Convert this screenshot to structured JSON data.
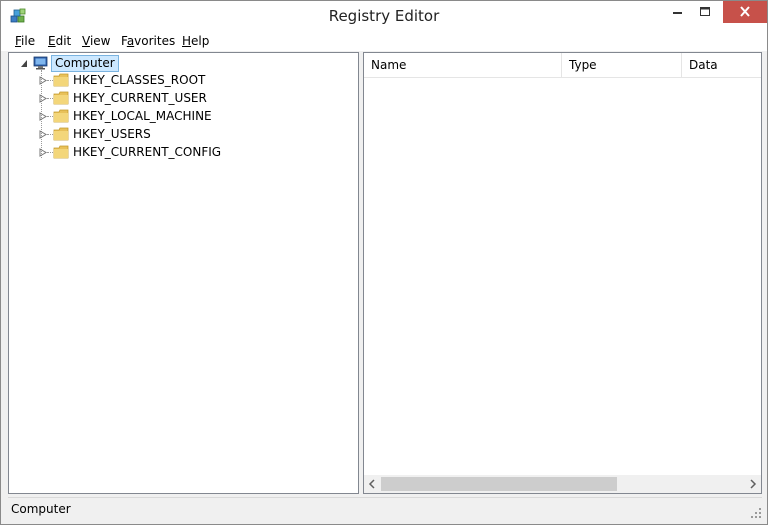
{
  "window": {
    "title": "Registry Editor",
    "icon": "registry-editor-icon"
  },
  "menu": [
    {
      "label": "File",
      "accel": "F",
      "rest": "ile"
    },
    {
      "label": "Edit",
      "accel": "E",
      "rest": "dit"
    },
    {
      "label": "View",
      "accel": "V",
      "rest": "iew"
    },
    {
      "label": "Favorites",
      "accel": "a",
      "pre": "F",
      "rest": "vorites"
    },
    {
      "label": "Help",
      "accel": "H",
      "rest": "elp"
    }
  ],
  "tree": {
    "root": {
      "label": "Computer",
      "icon": "computer-icon",
      "expanded": true,
      "selected": true
    },
    "children": [
      {
        "label": "HKEY_CLASSES_ROOT",
        "icon": "folder-icon",
        "expanded": false
      },
      {
        "label": "HKEY_CURRENT_USER",
        "icon": "folder-icon",
        "expanded": false
      },
      {
        "label": "HKEY_LOCAL_MACHINE",
        "icon": "folder-icon",
        "expanded": false
      },
      {
        "label": "HKEY_USERS",
        "icon": "folder-icon",
        "expanded": false
      },
      {
        "label": "HKEY_CURRENT_CONFIG",
        "icon": "folder-icon",
        "expanded": false
      }
    ]
  },
  "list": {
    "columns": [
      "Name",
      "Type",
      "Data"
    ],
    "rows": []
  },
  "status": {
    "text": "Computer"
  },
  "colors": {
    "close_button": "#c7514a",
    "selection": "#cce8ff",
    "folder": "#e8c15a"
  }
}
